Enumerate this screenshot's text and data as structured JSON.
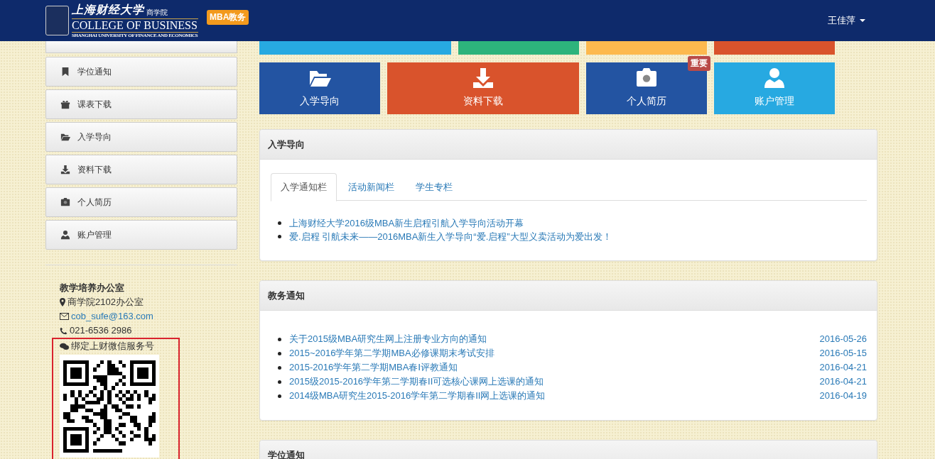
{
  "header": {
    "logo_chinese": "上海财经大学",
    "logo_suffix": "商学院",
    "logo_english": "COLLEGE OF BUSINESS",
    "logo_subtitle": "SHANGHAI UNIVERSITY OF FINANCE AND ECONOMICS",
    "badge": "MBA教务",
    "user": "王佳萍"
  },
  "sidebar": {
    "items": [
      {
        "label": "学位通知"
      },
      {
        "label": "课表下载"
      },
      {
        "label": "入学导向"
      },
      {
        "label": "资料下载"
      },
      {
        "label": "个人简历"
      },
      {
        "label": "账户管理"
      }
    ]
  },
  "contact": {
    "office": "教学培养办公室",
    "address": "商学院2102办公室",
    "email": "cob_sufe@163.com",
    "phone": "021-6536 2986",
    "wechat": "绑定上财微信服务号",
    "highlighted": true
  },
  "tiles_cut": [
    {
      "color": "#27a9e1"
    },
    {
      "color": "#2db37c"
    },
    {
      "color": "#fdb94e"
    },
    {
      "color": "#d9532c"
    }
  ],
  "tiles": [
    {
      "label": "入学导向",
      "color": "#2354a2"
    },
    {
      "label": "资料下载",
      "color": "#d9532c"
    },
    {
      "label": "个人简历",
      "color": "#2354a2",
      "badge": "重要"
    },
    {
      "label": "账户管理",
      "color": "#27a9e1"
    }
  ],
  "panels": [
    {
      "kind": "tabbed",
      "title": "入学导向",
      "tabs": [
        {
          "label": "入学通知栏",
          "selected": true
        },
        {
          "label": "活动新闻栏",
          "selected": false
        },
        {
          "label": "学生专栏",
          "selected": false
        }
      ],
      "items": [
        {
          "text": "上海财经大学2016级MBA新生启程引航入学导向活动开幕"
        },
        {
          "text": "爱.启程 引航未来——2016MBA新生入学导向“爱.启程”大型义卖活动为爱出发！"
        }
      ]
    },
    {
      "kind": "dated",
      "title": "教务通知",
      "items": [
        {
          "text": "关于2015级MBA研究生网上注册专业方向的通知",
          "date": "2016-05-26"
        },
        {
          "text": "2015~2016学年第二学期MBA必修课期末考试安排",
          "date": "2016-05-15"
        },
        {
          "text": "2015-2016学年第二学期MBA春Ⅰ评教通知",
          "date": "2016-04-21"
        },
        {
          "text": "2015级2015-2016学年第二学期春II可选核心课网上选课的通知",
          "date": "2016-04-21"
        },
        {
          "text": "2014级MBA研究生2015-2016学年第二学期春II网上选课的通知",
          "date": "2016-04-19"
        }
      ]
    },
    {
      "kind": "dated",
      "title": "学位通知"
    }
  ]
}
